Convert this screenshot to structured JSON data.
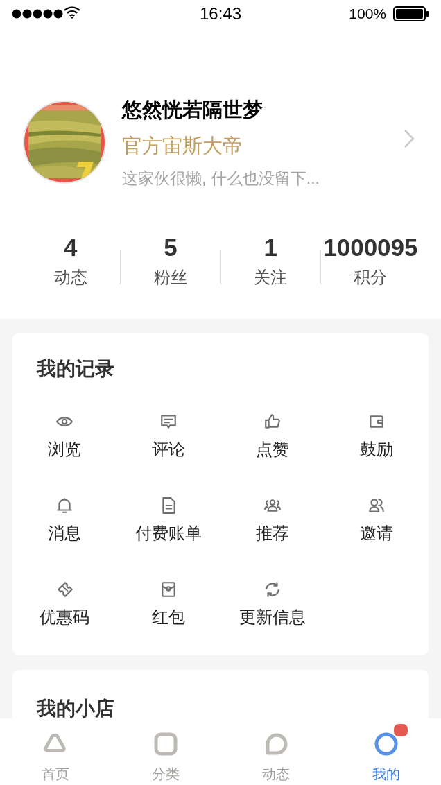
{
  "status_bar": {
    "time": "16:43",
    "battery": "100%"
  },
  "profile": {
    "name": "悠然恍若隔世梦",
    "title": "官方宙斯大帝",
    "bio": "这家伙很懒, 什么也没留下..."
  },
  "stats": [
    {
      "value": "4",
      "label": "动态"
    },
    {
      "value": "5",
      "label": "粉丝"
    },
    {
      "value": "1",
      "label": "关注"
    },
    {
      "value": "1000095",
      "label": "积分"
    }
  ],
  "records": {
    "title": "我的记录",
    "items": [
      {
        "label": "浏览"
      },
      {
        "label": "评论"
      },
      {
        "label": "点赞"
      },
      {
        "label": "鼓励"
      },
      {
        "label": "消息"
      },
      {
        "label": "付费账单"
      },
      {
        "label": "推荐"
      },
      {
        "label": "邀请"
      },
      {
        "label": "优惠码"
      },
      {
        "label": "红包"
      },
      {
        "label": "更新信息"
      }
    ]
  },
  "shop": {
    "title": "我的小店"
  },
  "tab_bar": [
    {
      "label": "首页",
      "selected": false,
      "badge": false
    },
    {
      "label": "分类",
      "selected": false,
      "badge": false
    },
    {
      "label": "动态",
      "selected": false,
      "badge": false
    },
    {
      "label": "我的",
      "selected": true,
      "badge": true
    }
  ]
}
